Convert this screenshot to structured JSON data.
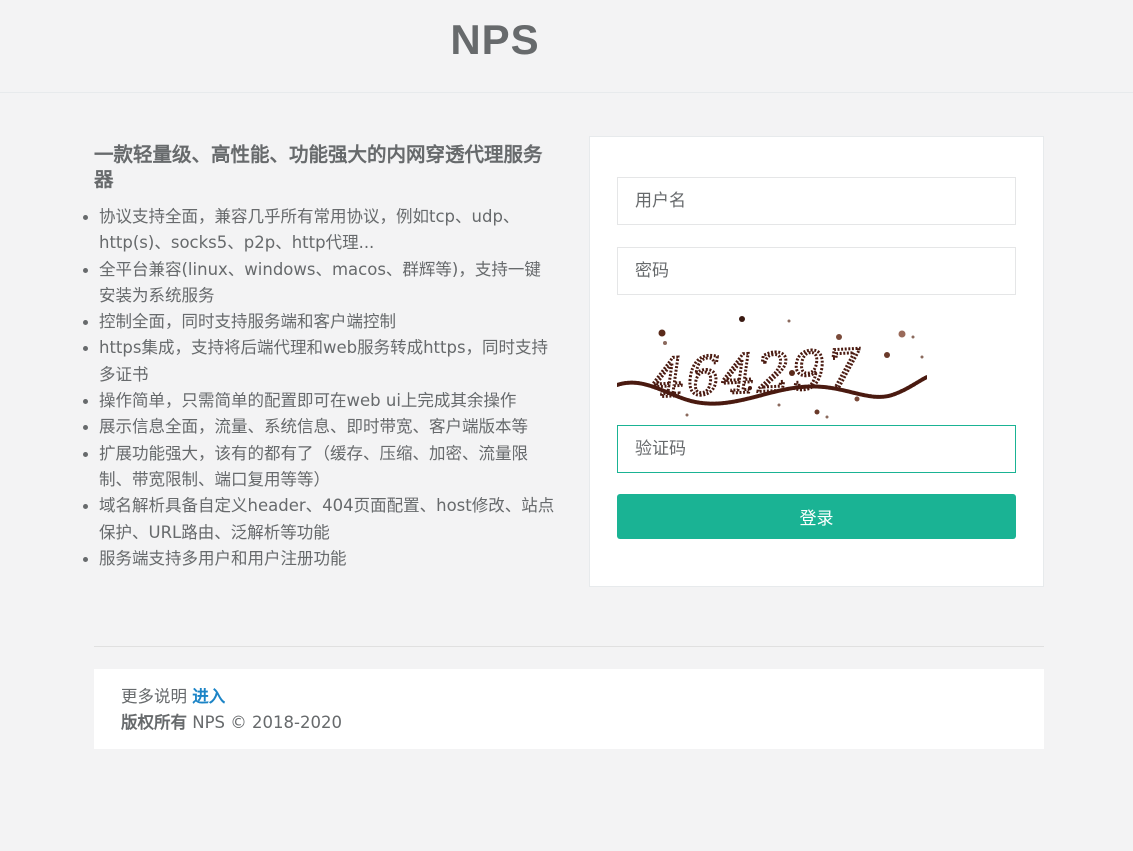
{
  "header": {
    "logo": "NPS"
  },
  "intro": {
    "title": "一款轻量级、高性能、功能强大的内网穿透代理服务器",
    "features": [
      "协议支持全面，兼容几乎所有常用协议，例如tcp、udp、http(s)、socks5、p2p、http代理...",
      "全平台兼容(linux、windows、macos、群辉等)，支持一键安装为系统服务",
      "控制全面，同时支持服务端和客户端控制",
      "https集成，支持将后端代理和web服务转成https，同时支持多证书",
      "操作简单，只需简单的配置即可在web ui上完成其余操作",
      "展示信息全面，流量、系统信息、即时带宽、客户端版本等",
      "扩展功能强大，该有的都有了（缓存、压缩、加密、流量限制、带宽限制、端口复用等等）",
      "域名解析具备自定义header、404页面配置、host修改、站点保护、URL路由、泛解析等功能",
      "服务端支持多用户和用户注册功能"
    ]
  },
  "login": {
    "username_placeholder": "用户名",
    "password_placeholder": "密码",
    "captcha_text": "464297",
    "captcha_placeholder": "验证码",
    "submit_label": "登录"
  },
  "footer": {
    "more_label": "更多说明",
    "more_link": "进入",
    "copyright_label": "版权所有",
    "copyright_text": "NPS © 2018-2020"
  },
  "colors": {
    "accent": "#1ab394",
    "link": "#1c84c6",
    "text": "#676a6c"
  }
}
